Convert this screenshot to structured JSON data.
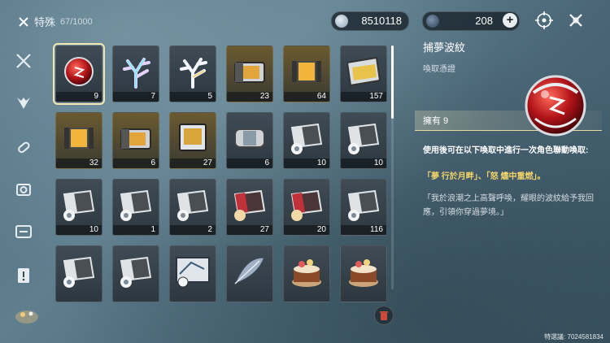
{
  "inventory": {
    "title": "特殊",
    "count": "67/1000"
  },
  "currency": [
    {
      "icon": "silver-coin-icon",
      "value": "8510118"
    },
    {
      "icon": "star-crystal-icon",
      "value": "208"
    }
  ],
  "sidebar": {
    "items": [
      "crossed-swords-icon",
      "mask-icon",
      "capsule-icon",
      "camera-icon",
      "card-icon",
      "alert-document-icon",
      "pet-icon"
    ]
  },
  "grid": {
    "rows": [
      [
        {
          "icon": "red-orb-icon",
          "qty": "9",
          "selected": true
        },
        {
          "icon": "rainbow-coral-icon",
          "qty": "7"
        },
        {
          "icon": "white-coral-icon",
          "qty": "5"
        },
        {
          "icon": "gold-crate-icon",
          "qty": "23"
        },
        {
          "icon": "gold-capsule-icon",
          "qty": "64"
        },
        {
          "icon": "silver-crate-icon",
          "qty": "157"
        }
      ],
      [
        {
          "icon": "gold-capsule-icon",
          "qty": "32"
        },
        {
          "icon": "gold-crate-icon",
          "qty": "6"
        },
        {
          "icon": "gold-box-icon",
          "qty": "27"
        },
        {
          "icon": "silver-capsule-icon",
          "qty": "6"
        },
        {
          "icon": "emblem-crate-icon",
          "qty": "10"
        },
        {
          "icon": "emblem-crate-icon",
          "qty": "10"
        }
      ],
      [
        {
          "icon": "emblem-crate-icon",
          "qty": "10"
        },
        {
          "icon": "emblem-crate-icon",
          "qty": "1"
        },
        {
          "icon": "emblem-crate-icon",
          "qty": "2"
        },
        {
          "icon": "red-crate-icon",
          "qty": "27"
        },
        {
          "icon": "red-crate-icon",
          "qty": "20"
        },
        {
          "icon": "emblem-crate-icon",
          "qty": "116"
        }
      ],
      [
        {
          "icon": "emblem-crate-icon",
          "qty": ""
        },
        {
          "icon": "emblem-crate-icon",
          "qty": ""
        },
        {
          "icon": "blueprint-icon",
          "qty": ""
        },
        {
          "icon": "feather-icon",
          "qty": ""
        },
        {
          "icon": "cake-icon",
          "qty": ""
        },
        {
          "icon": "cake-icon",
          "qty": ""
        }
      ]
    ]
  },
  "detail": {
    "name": "捕夢波紋",
    "type": "喚取憑證",
    "own": "擁有 9",
    "desc": "使用後可在以下喚取中進行一次角色聯動喚取:",
    "roles": "「夢 行於月畔」、「怒 燼中重燃」。",
    "quote": "「我於浪潮之上高聲呼喚，耀眼的波紋給予我回應，引領你穿過夢境。」"
  },
  "uid": "特選議: 7024581834",
  "colors": {
    "accent": "#f3d56a",
    "panel": "#2d373f"
  }
}
